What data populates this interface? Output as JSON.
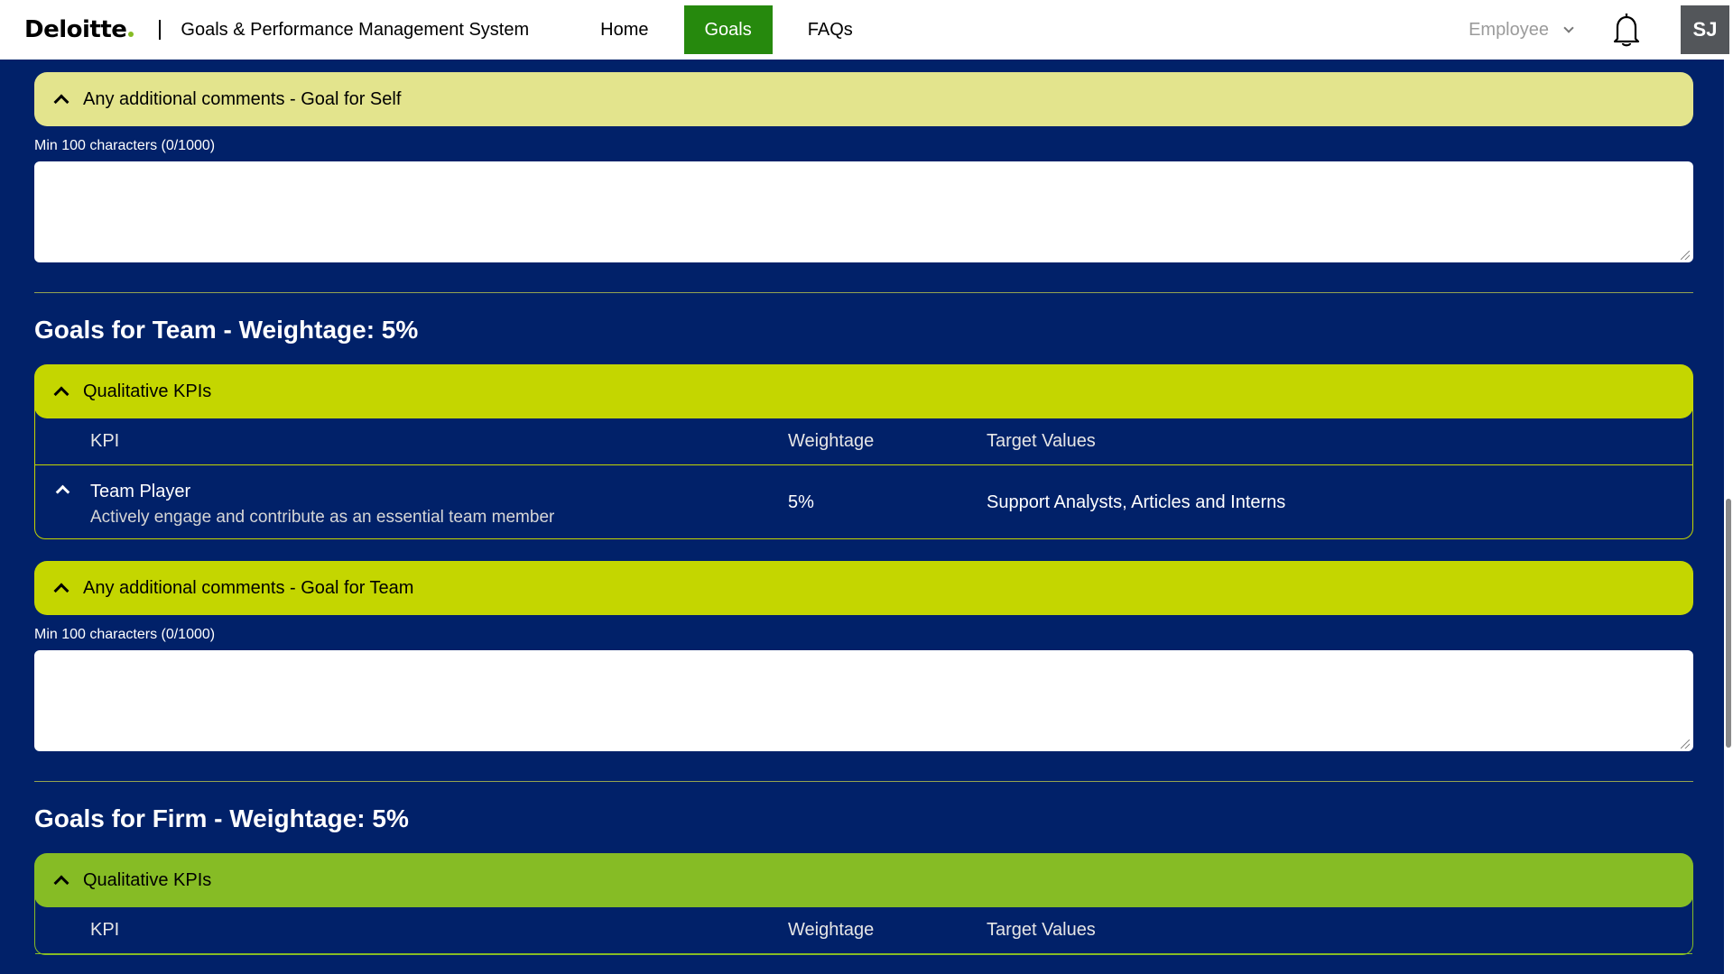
{
  "header": {
    "brand": "Deloitte",
    "app_title": "Goals & Performance Management System",
    "nav": [
      {
        "label": "Home"
      },
      {
        "label": "Goals"
      },
      {
        "label": "FAQs"
      }
    ],
    "active_nav": "Goals",
    "role": "Employee",
    "avatar_initials": "SJ"
  },
  "self_comments": {
    "title": "Any additional comments - Goal for Self",
    "hint": "Min 100 characters (0/1000)",
    "value": ""
  },
  "team": {
    "title": "Goals for Team - Weightage: 5%",
    "section_title": "Qualitative KPIs",
    "columns": {
      "kpi": "KPI",
      "weightage": "Weightage",
      "target": "Target Values"
    },
    "rows": [
      {
        "name": "Team Player",
        "description": "Actively engage and contribute as an essential team member",
        "weightage": "5%",
        "target": "Support Analysts, Articles and Interns"
      }
    ],
    "comments_title": "Any additional comments - Goal for Team",
    "comments_hint": "Min 100 characters (0/1000)",
    "comments_value": ""
  },
  "firm": {
    "title": "Goals for Firm - Weightage: 5%",
    "section_title": "Qualitative KPIs",
    "columns": {
      "kpi": "KPI",
      "weightage": "Weightage",
      "target": "Target Values"
    }
  },
  "colors": {
    "background": "#012169",
    "active_nav": "#26890d",
    "self_comment_header": "#e3e48d",
    "team_header": "#c4d600",
    "firm_header": "#86bc25"
  },
  "icons": [
    "bell-icon",
    "chevron-down-icon",
    "chevron-up-icon"
  ]
}
